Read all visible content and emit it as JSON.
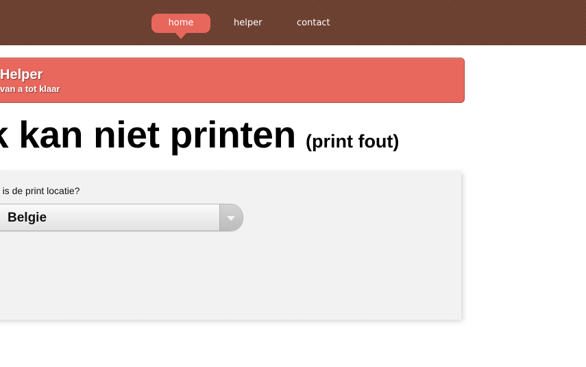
{
  "nav": {
    "items": [
      {
        "label": "home",
        "active": true
      },
      {
        "label": "helper",
        "active": false
      },
      {
        "label": "contact",
        "active": false
      }
    ]
  },
  "banner": {
    "title": "Helper",
    "subtitle": "van a tot klaar"
  },
  "page": {
    "title": "k kan niet printen",
    "subtitle": "(print fout)"
  },
  "form": {
    "location_label": "at is de print locatie?",
    "location_select": {
      "value": "Belgie"
    }
  },
  "colors": {
    "topbar": "#6d4030",
    "accent": "#e8675d",
    "paper": "#f4f4f4"
  }
}
